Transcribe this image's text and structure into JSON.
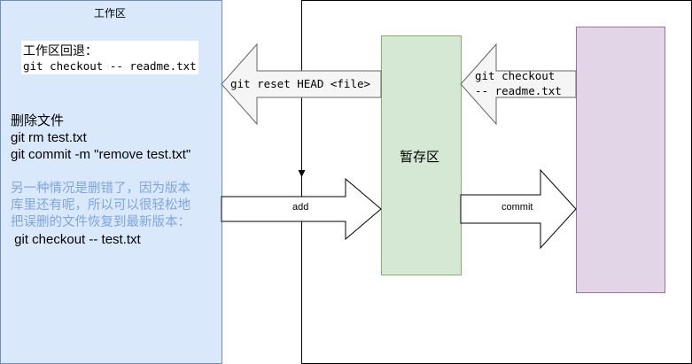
{
  "workspace": {
    "title": "工作区",
    "restore_heading": "工作区回退：",
    "restore_cmd": "git checkout -- readme.txt",
    "delete_title": "删除文件",
    "delete_cmd1": "git rm test.txt",
    "delete_cmd2": "git commit -m \"remove test.txt\"",
    "note_line1": "另一种情况是删错了，因为版本",
    "note_line2": "库里还有呢，所以可以很轻松地",
    "note_line3": "把误删的文件恢复到最新版本：",
    "recover_cmd": " git checkout -- test.txt"
  },
  "stage": {
    "label": "暂存区"
  },
  "arrows": {
    "reset_label": "git reset HEAD <file>",
    "checkout_line1": "git checkout",
    "checkout_line2": "-- readme.txt",
    "add_label": "add",
    "commit_label": "commit"
  },
  "colors": {
    "workspace_fill": "#dae8fc",
    "workspace_stroke": "#6c8ebf",
    "stage_fill": "#d5e8d4",
    "stage_stroke": "#82b366",
    "repo_fill": "#e1d5e7",
    "repo_stroke": "#9673a6",
    "arrow_gray": "#f5f5f5",
    "note_blue": "#7ea6e0"
  }
}
